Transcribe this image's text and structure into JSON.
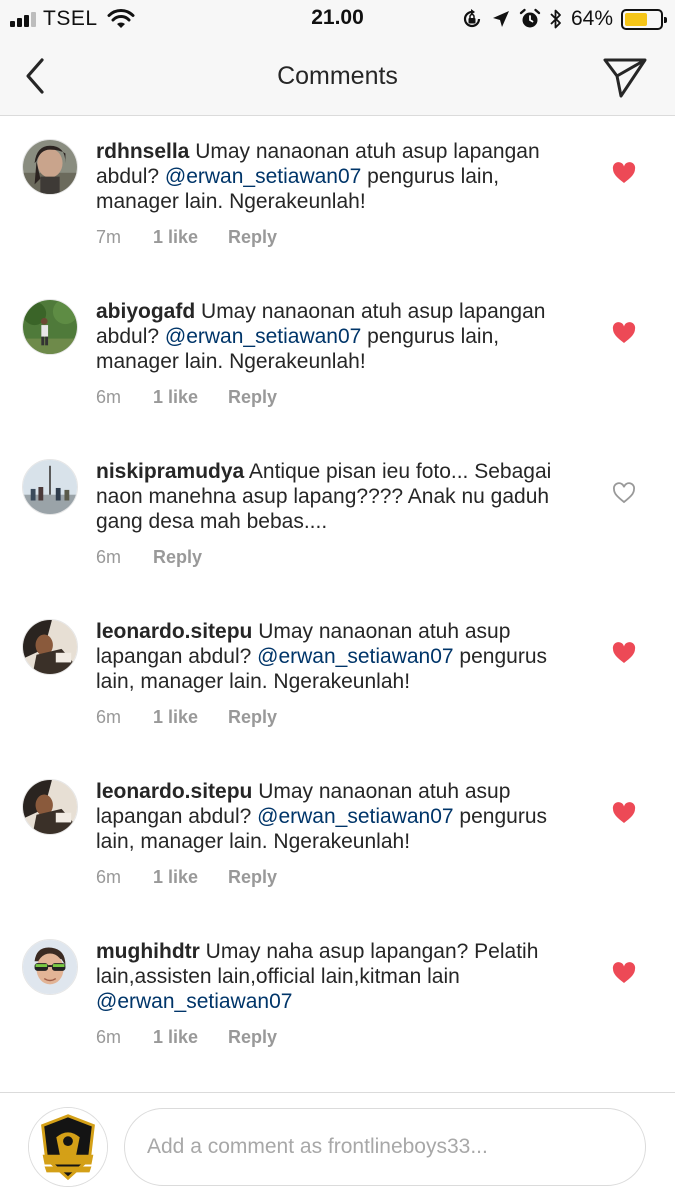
{
  "status_bar": {
    "carrier": "TSEL",
    "time": "21.00",
    "battery_percent": "64%",
    "battery_level": 0.64,
    "battery_color": "#f5c518"
  },
  "nav": {
    "title": "Comments",
    "back_icon": "chevron-left-icon",
    "send_icon": "direct-send-icon"
  },
  "colors": {
    "mention": "#003569",
    "liked_heart": "#ed4956",
    "meta_text": "#999999"
  },
  "comments": [
    {
      "username": "rdhnsella",
      "text_before": " Umay nanaonan atuh asup lapangan abdul? ",
      "mention": "@erwan_setiawan07",
      "text_after": " pengurus lain, manager lain. Ngerakeunlah!",
      "time": "7m",
      "likes": "1 like",
      "reply": "Reply",
      "liked": true
    },
    {
      "username": "abiyogafd",
      "text_before": " Umay nanaonan atuh asup lapangan abdul? ",
      "mention": "@erwan_setiawan07",
      "text_after": " pengurus lain, manager lain. Ngerakeunlah!",
      "time": "6m",
      "likes": "1 like",
      "reply": "Reply",
      "liked": true
    },
    {
      "username": "niskipramudya",
      "text_before": " Antique pisan ieu foto... Sebagai naon manehna asup lapang???? Anak nu gaduh gang desa mah bebas....",
      "mention": "",
      "text_after": "",
      "time": "6m",
      "likes": "",
      "reply": "Reply",
      "liked": false
    },
    {
      "username": "leonardo.sitepu",
      "text_before": " Umay nanaonan atuh asup lapangan abdul? ",
      "mention": "@erwan_setiawan07",
      "text_after": " pengurus lain, manager lain. Ngerakeunlah!",
      "time": "6m",
      "likes": "1 like",
      "reply": "Reply",
      "liked": true
    },
    {
      "username": "leonardo.sitepu",
      "text_before": " Umay nanaonan atuh asup lapangan abdul? ",
      "mention": "@erwan_setiawan07",
      "text_after": " pengurus lain, manager lain. Ngerakeunlah!",
      "time": "6m",
      "likes": "1 like",
      "reply": "Reply",
      "liked": true
    },
    {
      "username": "mughihdtr",
      "text_before": " Umay naha asup lapangan? Pelatih lain,assisten lain,official lain,kitman lain ",
      "mention": "@erwan_setiawan07",
      "text_after": "",
      "time": "6m",
      "likes": "1 like",
      "reply": "Reply",
      "liked": true
    }
  ],
  "composer": {
    "placeholder": "Add a comment as frontlineboys33...",
    "value": "",
    "avatar_logo_text": "FRONTLINE"
  }
}
